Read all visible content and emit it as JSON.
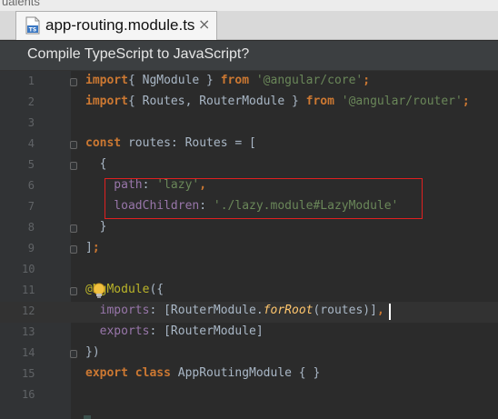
{
  "window": {
    "top_strip_text": "ualents"
  },
  "tab": {
    "icon_label": "TS",
    "filename": "app-routing.module.ts",
    "close_glyph": "×"
  },
  "notification": {
    "text": "Compile TypeScript to JavaScript?"
  },
  "editor": {
    "lines": [
      {
        "n": "1",
        "tokens": [
          [
            "kw",
            "import"
          ],
          [
            "",
            "{ NgModule } "
          ],
          [
            "kw",
            "from"
          ],
          [
            "str",
            " '@angular/core'"
          ],
          [
            "kw",
            ";"
          ]
        ]
      },
      {
        "n": "2",
        "tokens": [
          [
            "kw",
            "import"
          ],
          [
            "",
            "{ Routes, RouterModule } "
          ],
          [
            "kw",
            "from"
          ],
          [
            "str",
            " '@angular/router'"
          ],
          [
            "kw",
            ";"
          ]
        ]
      },
      {
        "n": "3",
        "tokens": []
      },
      {
        "n": "4",
        "tokens": [
          [
            "kw",
            "const"
          ],
          [
            "",
            " routes: Routes = ["
          ]
        ]
      },
      {
        "n": "5",
        "tokens": [
          [
            "",
            "  {"
          ]
        ]
      },
      {
        "n": "6",
        "tokens": [
          [
            "prop",
            "    path"
          ],
          [
            "",
            ": "
          ],
          [
            "str",
            "'lazy'"
          ],
          [
            "kw",
            ","
          ]
        ]
      },
      {
        "n": "7",
        "tokens": [
          [
            "prop",
            "    loadChildren"
          ],
          [
            "",
            ": "
          ],
          [
            "str",
            "'./lazy.module#LazyModule'"
          ]
        ]
      },
      {
        "n": "8",
        "tokens": [
          [
            "",
            "  }"
          ]
        ]
      },
      {
        "n": "9",
        "tokens": [
          [
            "",
            "]"
          ],
          [
            "kw",
            ";"
          ]
        ]
      },
      {
        "n": "10",
        "tokens": []
      },
      {
        "n": "11",
        "tokens": [
          [
            "ann",
            "@NgModule"
          ],
          [
            "",
            "({"
          ]
        ]
      },
      {
        "n": "12",
        "tokens": [
          [
            "prop",
            "  imports"
          ],
          [
            "",
            ": [RouterModule."
          ],
          [
            "fn",
            "forRoot"
          ],
          [
            "",
            "(routes)]"
          ],
          [
            "kw",
            ","
          ]
        ]
      },
      {
        "n": "13",
        "tokens": [
          [
            "prop",
            "  exports"
          ],
          [
            "",
            ": [RouterModule]"
          ]
        ]
      },
      {
        "n": "14",
        "tokens": [
          [
            "",
            "})"
          ]
        ]
      },
      {
        "n": "15",
        "tokens": [
          [
            "kw",
            "export class"
          ],
          [
            "",
            " AppRoutingModule { }"
          ]
        ]
      },
      {
        "n": "16",
        "tokens": []
      }
    ]
  },
  "colors": {
    "editor_bg": "#2b2b2b",
    "keyword": "#cc7832",
    "string": "#6a8759",
    "property": "#9876aa",
    "function": "#ffc66d",
    "highlight_box": "#e02020"
  },
  "icons": {
    "file_type": "typescript-file-icon",
    "intention": "lightbulb-icon",
    "fold": "fold-marker-icon"
  }
}
